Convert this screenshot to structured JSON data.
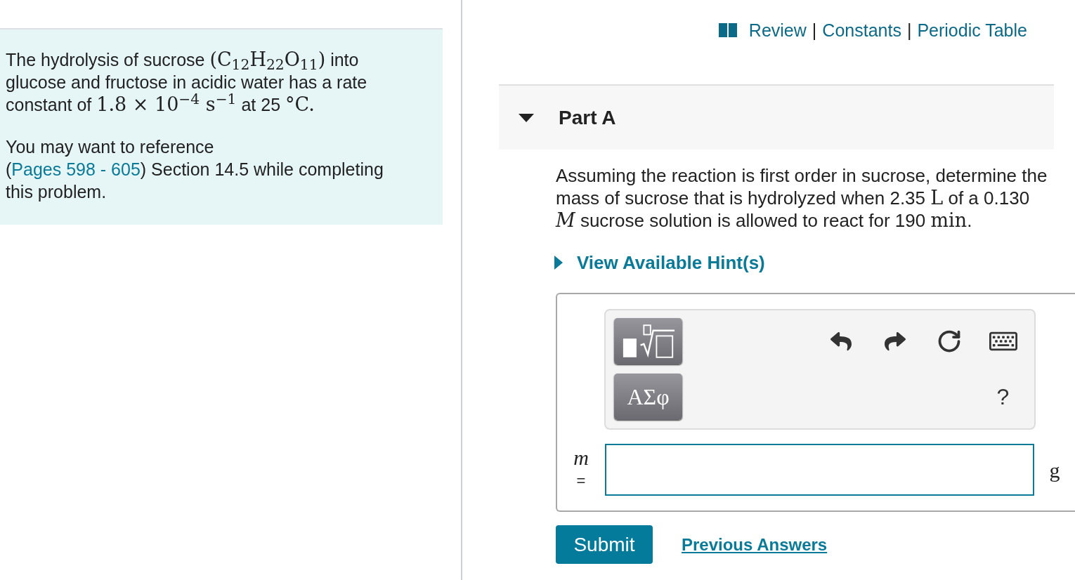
{
  "intro": {
    "paragraphs": [
      [
        {
          "kind": "text",
          "text": "The hydrolysis of sucrose "
        },
        {
          "kind": "math",
          "text": "(C$_{12}$H$_{22}$O$_{11}$)"
        },
        {
          "kind": "text",
          "text": " into glucose and fructose in acidic water has a rate constant of "
        },
        {
          "kind": "math",
          "text": "1.8 × 10$^{−4}$ s$^{−1}$"
        },
        {
          "kind": "text",
          "text": " at 25 "
        },
        {
          "kind": "math",
          "text": "°C."
        }
      ],
      [
        {
          "kind": "text",
          "text": "You may want to reference"
        },
        {
          "kind": "break"
        },
        {
          "kind": "text",
          "text": "("
        },
        {
          "kind": "link",
          "text": "Pages 598 - 605"
        },
        {
          "kind": "text",
          "text": ") Section 14.5 while completing this problem."
        }
      ]
    ]
  },
  "top_links": {
    "items": [
      "Review",
      "Constants",
      "Periodic Table"
    ],
    "separators": [
      "|",
      "|"
    ]
  },
  "part": {
    "title": "Part A",
    "expanded": true,
    "question": [
      {
        "kind": "text",
        "text": "Assuming the reaction is first order in sucrose, determine the mass of sucrose that is hydrolyzed when 2.35 "
      },
      {
        "kind": "math",
        "text": "L"
      },
      {
        "kind": "text",
        "text": " of a 0.130 "
      },
      {
        "kind": "math",
        "text": "*M*"
      },
      {
        "kind": "text",
        "text": " sucrose solution is allowed to react for 190 "
      },
      {
        "kind": "math",
        "text": "min"
      },
      {
        "kind": "text",
        "text": "."
      }
    ],
    "hints": {
      "label": "View Available Hint(s)",
      "expanded": false
    },
    "answer": {
      "greek_button": "ΑΣφ",
      "help_button": "?",
      "variable": "m",
      "equals": "=",
      "unit": "g"
    },
    "submit": "Submit",
    "previous_answers": "Previous Answers"
  }
}
